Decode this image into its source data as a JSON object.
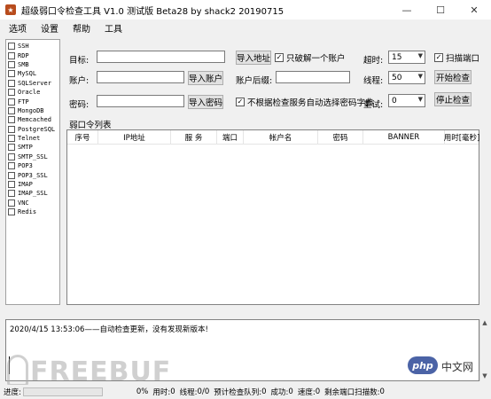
{
  "window": {
    "title": "超级弱口令检查工具 V1.0 测试版 Beta28 by shack2 20190715",
    "min": "—",
    "max": "☐",
    "close": "✕"
  },
  "menu": [
    "选项",
    "设置",
    "帮助",
    "工具"
  ],
  "protocols": [
    {
      "label": "SSH",
      "checked": false
    },
    {
      "label": "RDP",
      "checked": false
    },
    {
      "label": "SMB",
      "checked": false
    },
    {
      "label": "MySQL",
      "checked": false
    },
    {
      "label": "SQLServer",
      "checked": false
    },
    {
      "label": "Oracle",
      "checked": false
    },
    {
      "label": "FTP",
      "checked": false
    },
    {
      "label": "MongoDB",
      "checked": false
    },
    {
      "label": "Memcached",
      "checked": false
    },
    {
      "label": "PostgreSQL",
      "checked": false
    },
    {
      "label": "Telnet",
      "checked": false
    },
    {
      "label": "SMTP",
      "checked": false
    },
    {
      "label": "SMTP_SSL",
      "checked": false
    },
    {
      "label": "POP3",
      "checked": false
    },
    {
      "label": "POP3_SSL",
      "checked": false
    },
    {
      "label": "IMAP",
      "checked": false
    },
    {
      "label": "IMAP_SSL",
      "checked": false
    },
    {
      "label": "VNC",
      "checked": false
    },
    {
      "label": "Redis",
      "checked": false
    }
  ],
  "form": {
    "target_label": "目标:",
    "target_value": "",
    "import_address": "导入地址",
    "only_one_account": "只破解一个账户",
    "only_one_checked": true,
    "account_label": "账户:",
    "account_value": "",
    "import_account": "导入账户",
    "account_suffix_label": "账户后缀:",
    "account_suffix_value": "",
    "password_label": "密码:",
    "password_value": "",
    "import_password": "导入密码",
    "no_auto_dict": "不根据检查服务自动选择密码字典",
    "no_auto_dict_checked": true,
    "timeout_label": "超时:",
    "timeout_value": "15",
    "threads_label": "线程:",
    "threads_value": "50",
    "retry_label": "重试:",
    "retry_value": "0",
    "scan_port": "扫描端口",
    "scan_port_checked": true,
    "start_btn": "开始检查",
    "stop_btn": "停止检查"
  },
  "table": {
    "group_label": "弱口令列表",
    "columns": [
      "序号",
      "IP地址",
      "服 务",
      "端口",
      "帐户名",
      "密码",
      "BANNER",
      "用时[毫秒]"
    ],
    "rows": []
  },
  "log": {
    "lines": [
      "2020/4/15 13:53:06——自动检查更新，没有发现新版本!"
    ]
  },
  "status": {
    "progress_label": "进度:",
    "progress_fraction": 0,
    "percent": "0%",
    "time_label": "用时:",
    "time_value": "0",
    "threads_label": "线程:",
    "threads_value": "0/0",
    "queue_label": "预计检查队列:",
    "queue_value": "0",
    "success_label": "成功:",
    "success_value": "0",
    "speed_label": "速度:",
    "speed_value": "0",
    "remaining_label": "剩余端口扫描数:",
    "remaining_value": "0"
  },
  "watermark": {
    "text": "FREEBUF",
    "php": "php",
    "cn": "中文网"
  }
}
